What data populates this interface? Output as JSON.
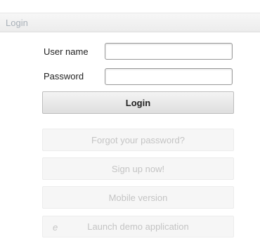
{
  "panel": {
    "title": "Login"
  },
  "form": {
    "username_label": "User name",
    "username_value": "",
    "password_label": "Password",
    "password_value": ""
  },
  "buttons": {
    "login": "Login",
    "forgot_password": "Forgot your password?",
    "sign_up": "Sign up now!",
    "mobile": "Mobile version",
    "demo": "Launch demo application",
    "demo_icon": "ie-browser-icon"
  }
}
